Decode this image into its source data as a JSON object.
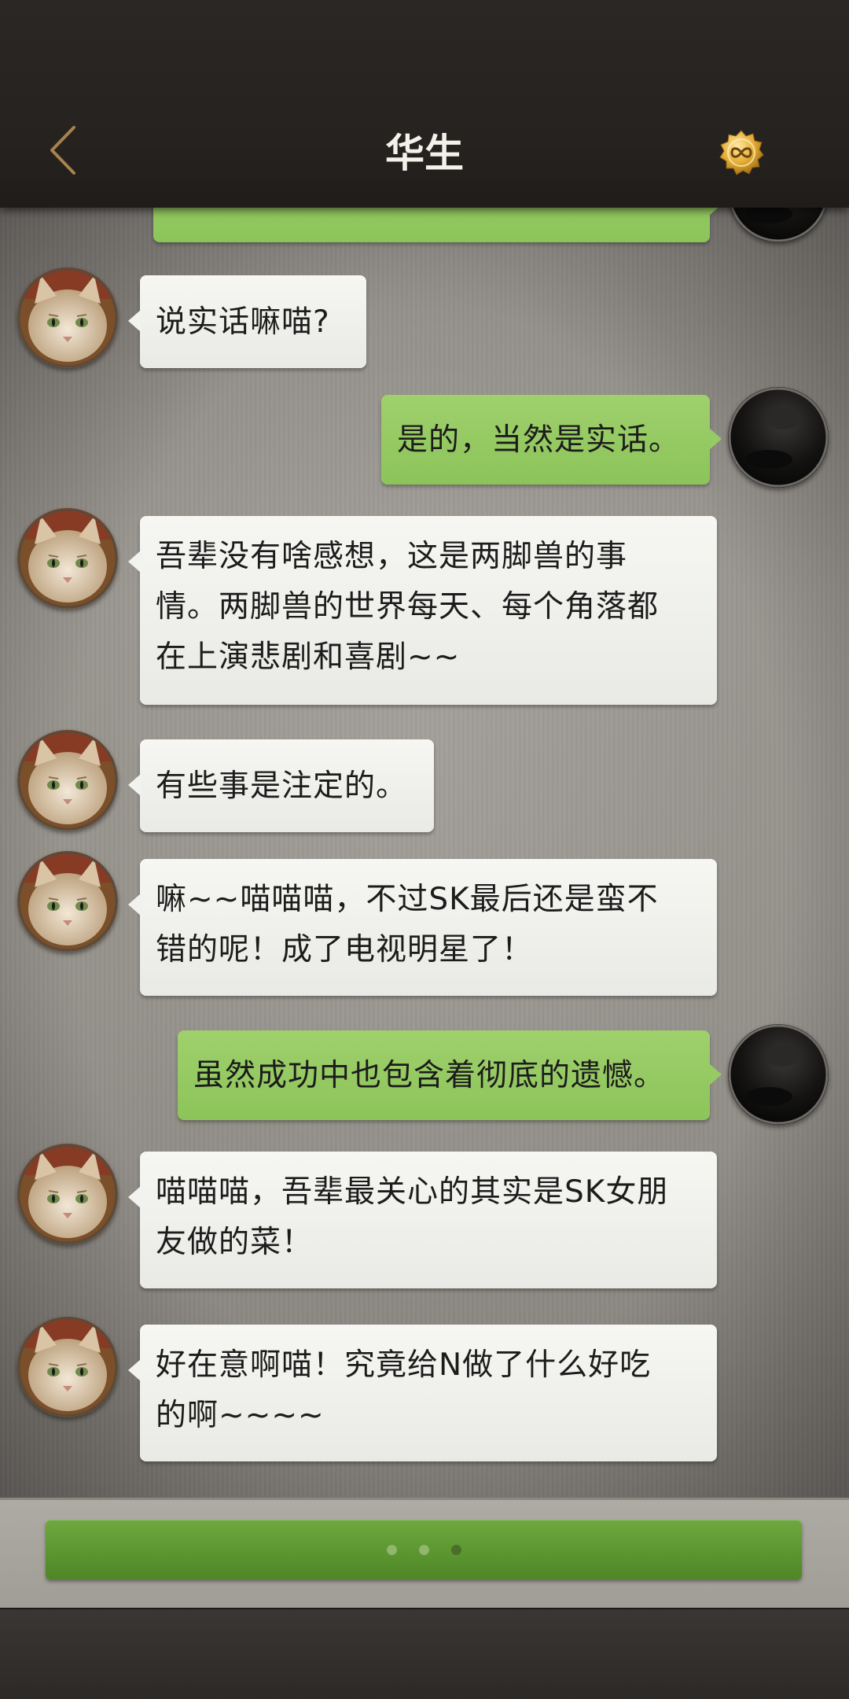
{
  "header": {
    "title": "华生",
    "back_icon": "chevron-left-icon",
    "coin_icon": "infinity-coin-icon"
  },
  "messages": [
    {
      "sender": "me",
      "text": "",
      "partial": true
    },
    {
      "sender": "cat",
      "text": "说实话嘛喵?"
    },
    {
      "sender": "me",
      "text": "是的，当然是实话。"
    },
    {
      "sender": "cat",
      "lines": [
        "吾辈没有啥感想，这是两脚兽的事",
        "情。两脚兽的世界每天、每个角落都",
        "在上演悲剧和喜剧~~"
      ]
    },
    {
      "sender": "cat",
      "text": "有些事是注定的。"
    },
    {
      "sender": "cat",
      "lines": [
        "嘛~~喵喵喵，不过SK最后还是蛮不",
        "错的呢！成了电视明星了！"
      ]
    },
    {
      "sender": "me",
      "text": "虽然成功中也包含着彻底的遗憾。"
    },
    {
      "sender": "cat",
      "lines": [
        "喵喵喵，吾辈最关心的其实是SK女朋",
        "友做的菜！"
      ]
    },
    {
      "sender": "cat",
      "lines": [
        "好在意啊喵！究竟给N做了什么好吃",
        "的啊~~~~"
      ]
    }
  ],
  "typing_indicator": {
    "dot_count": 3,
    "active_dot": 3
  },
  "colors": {
    "header_bg": "#252220",
    "title_text": "#f4f0ea",
    "cat_bubble": "#efefec",
    "me_bubble": "#94c862",
    "action_bar": "#5b9630",
    "back_chevron": "#a8824a",
    "coin": "#d9a22e"
  }
}
